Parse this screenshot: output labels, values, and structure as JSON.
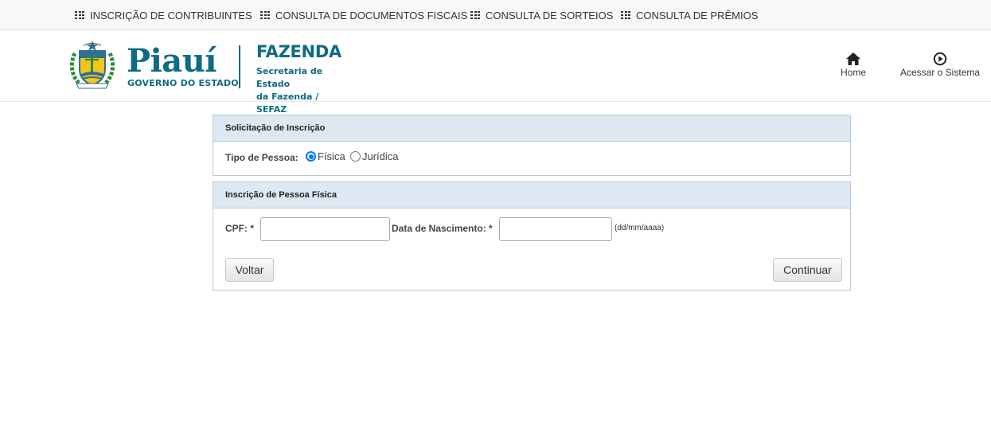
{
  "topnav": {
    "items": [
      {
        "label": "INSCRIÇÃO DE CONTRIBUINTES",
        "icon": "grid-icon"
      },
      {
        "label": "CONSULTA DE DOCUMENTOS FISCAIS",
        "icon": "grid-icon"
      },
      {
        "label": "CONSULTA DE SORTEIOS",
        "icon": "grid-icon"
      },
      {
        "label": "CONSULTA DE PRÊMIOS",
        "icon": "grid-icon"
      }
    ]
  },
  "header": {
    "logo": {
      "brand": "Piauí",
      "tagline": "GOVERNO DO ESTADO",
      "department": "FAZENDA",
      "subtitle_line1": "Secretaria de Estado",
      "subtitle_line2": "da Fazenda / SEFAZ",
      "brand_color": "#0f6a84"
    },
    "links": {
      "home": {
        "label": "Home",
        "icon": "home-icon"
      },
      "access": {
        "label": "Acessar o Sistema",
        "icon": "play-circle-icon"
      }
    }
  },
  "request_panel": {
    "title": "Solicitação de Inscrição",
    "person_type_label": "Tipo de Pessoa:",
    "options": [
      {
        "label": "Física",
        "selected": true
      },
      {
        "label": "Jurídica",
        "selected": false
      }
    ]
  },
  "person_panel": {
    "title": "Inscrição de Pessoa Física",
    "cpf_label": "CPF: *",
    "cpf_value": "",
    "birth_label": "Data de Nascimento: *",
    "birth_value": "",
    "birth_hint": "(dd/mm/aaaa)",
    "back_button": "Voltar",
    "continue_button": "Continuar"
  },
  "colors": {
    "panel_header_bg": "#dde8f3",
    "panel_border": "#b9cbd9",
    "radio_accent": "#0075ff"
  }
}
